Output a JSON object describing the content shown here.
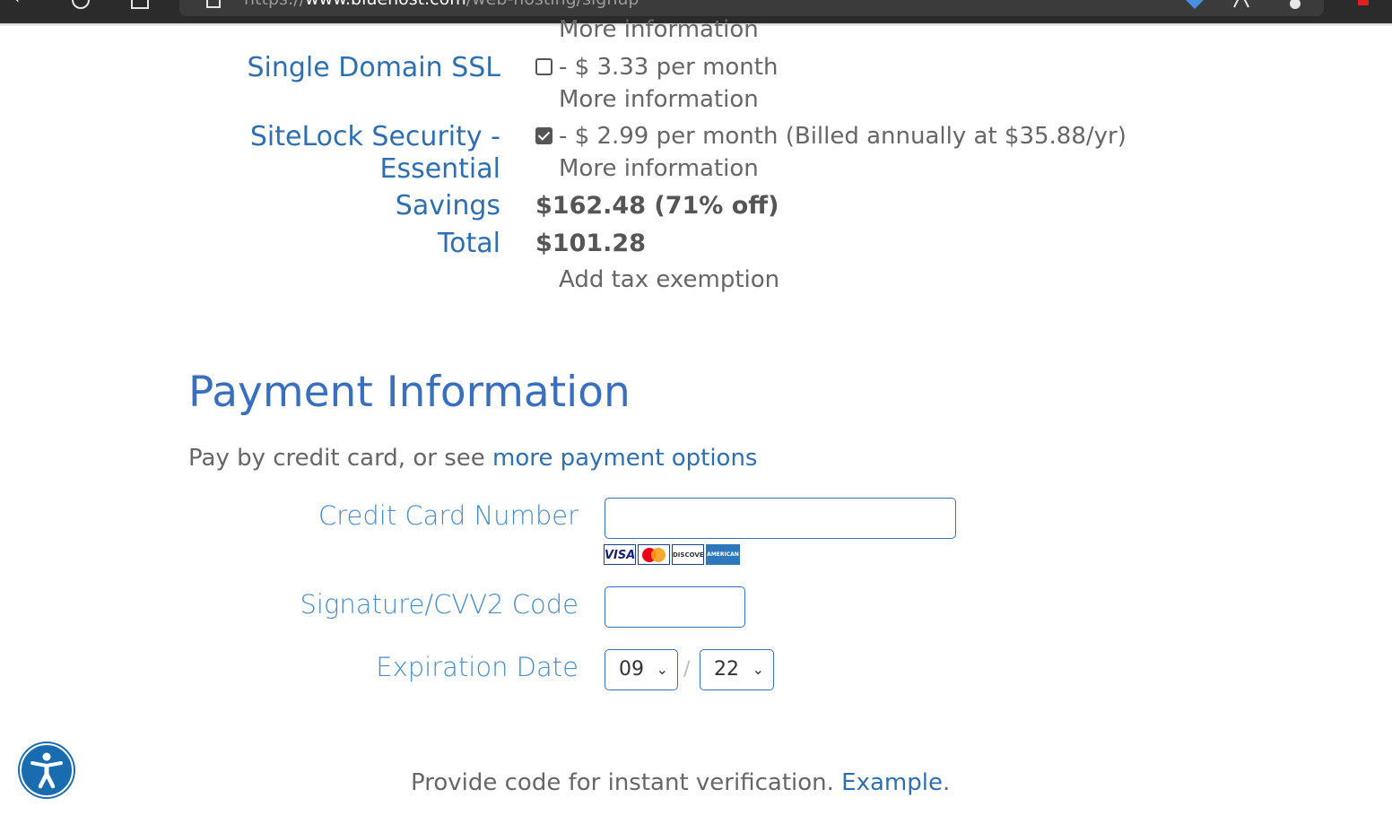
{
  "browser": {
    "url_prefix": "https://",
    "url_host": "www.bluehost.com",
    "url_path": "/web-hosting/signup"
  },
  "addons": {
    "more_info_top": "More information",
    "ssl": {
      "label": "Single Domain SSL",
      "checked": false,
      "price": "- $ 3.33 per month",
      "more_info": "More information"
    },
    "sitelock": {
      "label_line1": "SiteLock Security -",
      "label_line2": "Essential",
      "checked": true,
      "price": "- $ 2.99 per month (Billed annually at $35.88/yr)",
      "more_info": "More information"
    }
  },
  "summary": {
    "savings_label": "Savings",
    "savings_value": "$162.48 (71% off)",
    "total_label": "Total",
    "total_value": "$101.28",
    "tax_link": "Add tax exemption"
  },
  "payment": {
    "title": "Payment Information",
    "intro_text": "Pay by credit card, or see ",
    "intro_link": "more payment options",
    "cc_label": "Credit Card Number",
    "cc_value": "",
    "card_logos": [
      "VISA",
      "MasterCard",
      "DISCOVER",
      "AMERICAN EXPRESS"
    ],
    "cvv_label": "Signature/CVV2 Code",
    "cvv_value": "",
    "exp_label": "Expiration Date",
    "exp_month": "09",
    "exp_sep": "/",
    "exp_year": "22"
  },
  "footer": {
    "verify_text": "Provide code for instant verification. ",
    "verify_link": "Example",
    "verify_end": "."
  },
  "colors": {
    "link_blue": "#2f6fb0",
    "heading_blue": "#3a6fbf",
    "accessibility_blue": "#1a6cb0"
  }
}
